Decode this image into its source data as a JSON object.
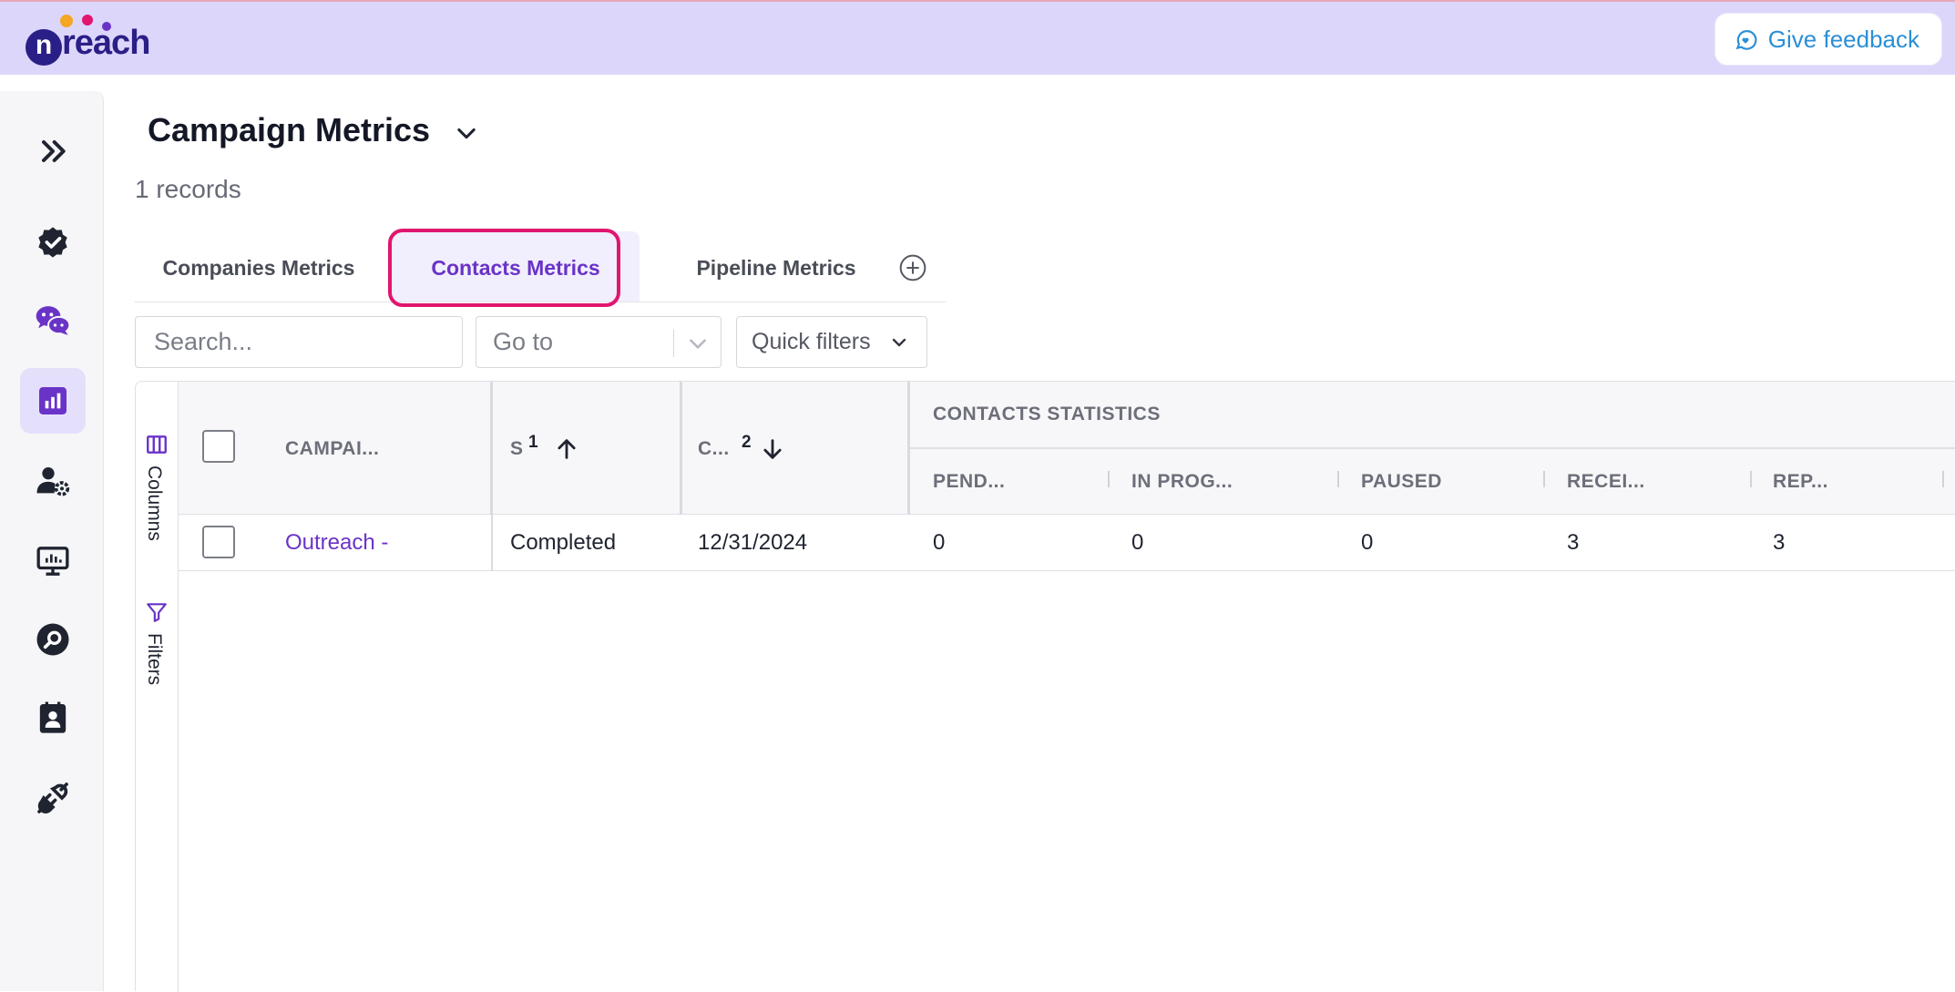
{
  "app": {
    "logo_letter": "n",
    "logo_text": "reach",
    "feedback_label": "Give feedback"
  },
  "page": {
    "title": "Campaign Metrics",
    "records": "1 records"
  },
  "tabs": [
    {
      "label": "Companies Metrics",
      "active": false
    },
    {
      "label": "Contacts Metrics",
      "active": true
    },
    {
      "label": "Pipeline Metrics",
      "active": false
    }
  ],
  "toolbar": {
    "search_placeholder": "Search...",
    "goto_placeholder": "Go to",
    "quick_filters_label": "Quick filters"
  },
  "grid": {
    "side_columns_label": "Columns",
    "side_filters_label": "Filters",
    "group_header": "CONTACTS STATISTICS",
    "columns": {
      "campaign": "CAMPAI...",
      "status": "S",
      "status_sort_index": "1",
      "created": "C...",
      "created_sort_index": "2",
      "pending": "PEND...",
      "in_progress": "IN PROG...",
      "paused": "PAUSED",
      "received": "RECEI...",
      "replied": "REP..."
    },
    "rows": [
      {
        "campaign": "Outreach -",
        "status": "Completed",
        "created": "12/31/2024",
        "pending": "0",
        "in_progress": "0",
        "paused": "0",
        "received": "3",
        "replied": "3"
      }
    ]
  },
  "colors": {
    "topbar": "#dcd6fb",
    "accent": "#6a33c7",
    "highlight": "#e1166f",
    "feedback_text": "#2a8fd6"
  }
}
